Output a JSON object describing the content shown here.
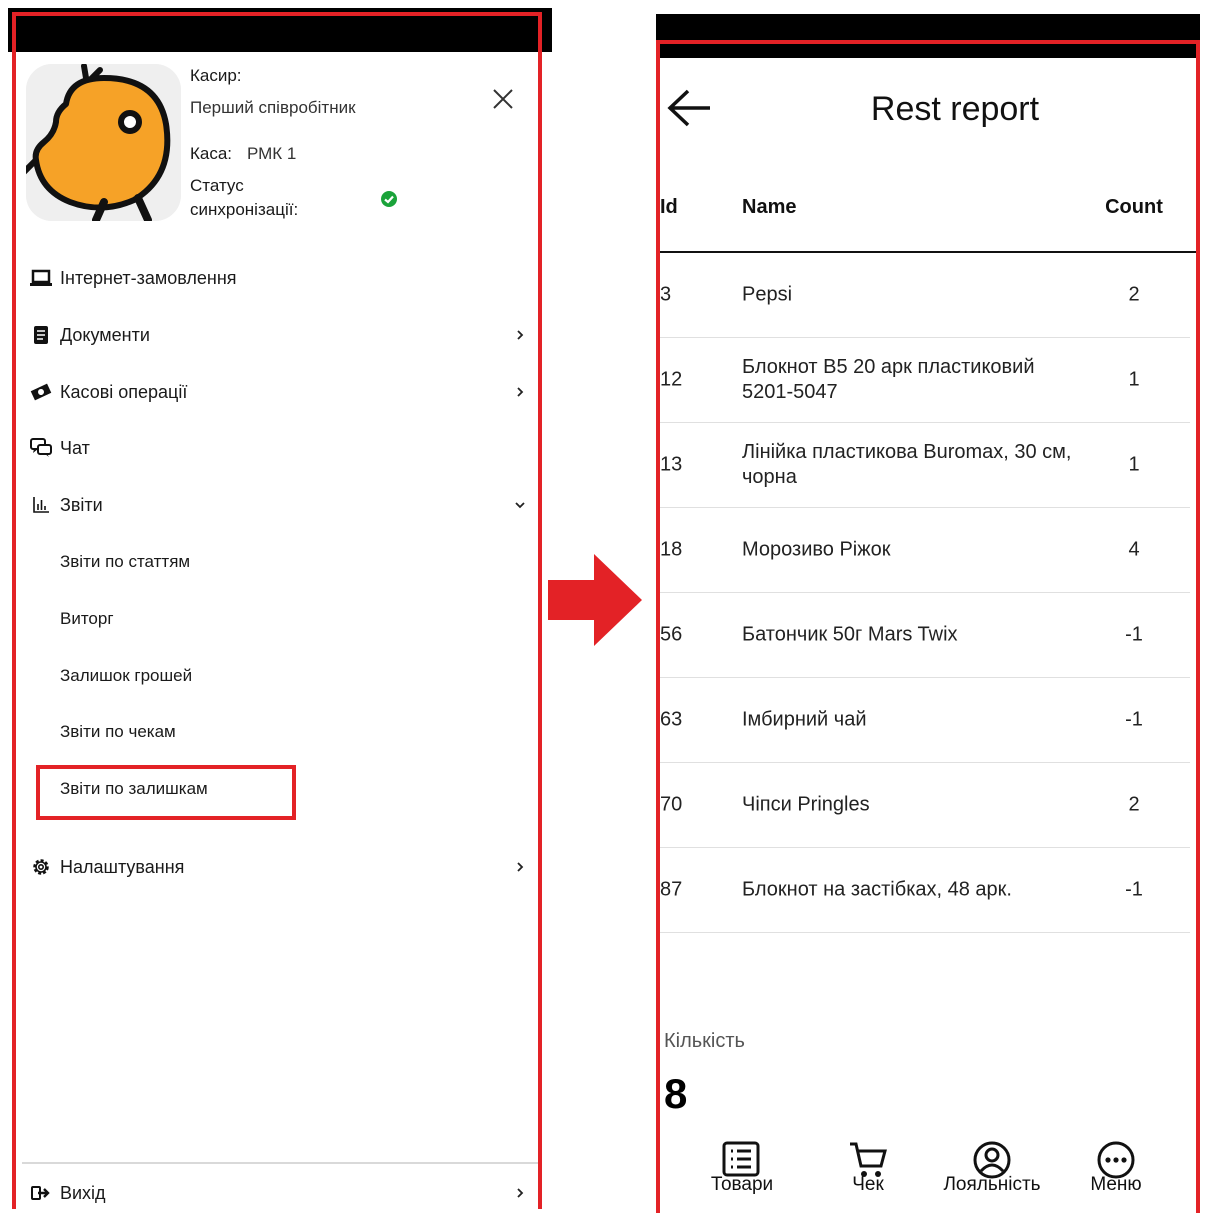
{
  "colors": {
    "accent": "#e32226",
    "status_ok": "#1aa33a",
    "mascot": "#f6a227"
  },
  "left": {
    "avatar_icon": "chick-mascot-icon",
    "cashier_label": "Касир:",
    "cashier_name": "Перший співробітник",
    "register_label": "Каса:",
    "register_value": "РМК 1",
    "sync_label_line1": "Статус",
    "sync_label_line2": "синхронізації:",
    "sync_status_icon": "check-circle-icon",
    "menu": [
      {
        "label": "Інтернет-замовлення",
        "icon": "laptop-icon"
      },
      {
        "label": "Документи",
        "icon": "document-icon"
      },
      {
        "label": "Касові операції",
        "icon": "money-icon"
      },
      {
        "label": "Чат",
        "icon": "chat-icon"
      },
      {
        "label": "Звіти",
        "icon": "bar-chart-icon"
      }
    ],
    "reports_sub": [
      "Звіти по статтям",
      "Виторг",
      "Залишок грошей",
      "Звіти по чекам",
      "Звіти по залишкам"
    ],
    "settings": {
      "label": "Налаштування",
      "icon": "gear-icon"
    },
    "logout": {
      "label": "Вихід",
      "icon": "logout-icon"
    }
  },
  "right": {
    "title": "Rest report",
    "columns": {
      "id": "Id",
      "name": "Name",
      "count": "Count"
    },
    "rows": [
      {
        "id": "3",
        "name": "Pepsi",
        "count": "2"
      },
      {
        "id": "12",
        "name": "Блокнот B5 20 арк пластиковий 5201-5047",
        "count": "1"
      },
      {
        "id": "13",
        "name": "Лінійка пластикова Buromax, 30 см, чорна",
        "count": "1"
      },
      {
        "id": "18",
        "name": "Морозиво Ріжок",
        "count": "4"
      },
      {
        "id": "56",
        "name": "Батончик 50г Mars Twix",
        "count": "-1"
      },
      {
        "id": "63",
        "name": "Імбирний чай",
        "count": "-1"
      },
      {
        "id": "70",
        "name": "Чіпси Pringles",
        "count": "2"
      },
      {
        "id": "87",
        "name": "Блокнот на застібках, 48 арк.",
        "count": "-1"
      }
    ],
    "qty_label": "Кількість",
    "qty_value": "8",
    "tabs": [
      {
        "label": "Товари",
        "icon": "list-icon"
      },
      {
        "label": "Чек",
        "icon": "cart-icon"
      },
      {
        "label": "Лояльність",
        "icon": "user-circle-icon"
      },
      {
        "label": "Меню",
        "icon": "more-icon"
      }
    ]
  }
}
